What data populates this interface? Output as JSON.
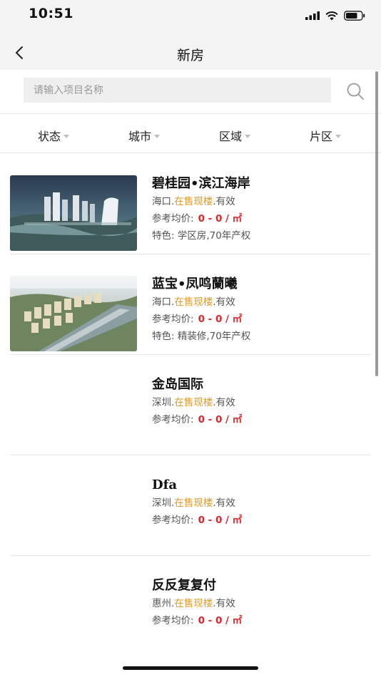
{
  "status_bar": {
    "time": "10:51"
  },
  "nav": {
    "title": "新房"
  },
  "search": {
    "placeholder": "请输入项目名称"
  },
  "filters": [
    "状态",
    "城市",
    "区域",
    "片区"
  ],
  "listings": [
    {
      "name": "碧桂园•滨江海岸",
      "city": "海口.",
      "status": "在售现楼",
      "validity": ".有效",
      "price_label": "参考均价:",
      "price": "0 - 0 / ㎡",
      "feature": "特色:  学区房,70年产权",
      "has_image": true
    },
    {
      "name": "蓝宝•凤鸣蘭曦",
      "city": "海口.",
      "status": "在售现楼",
      "validity": ".有效",
      "price_label": "参考均价:",
      "price": "0 - 0 / ㎡",
      "feature": "特色:  精装修,70年产权",
      "has_image": true
    },
    {
      "name": "金岛国际",
      "city": "深圳.",
      "status": "在售现楼",
      "validity": ".有效",
      "price_label": "参考均价:",
      "price": "0 - 0 / ㎡",
      "feature": "",
      "has_image": false
    },
    {
      "name": "Dfa",
      "city": "深圳.",
      "status": "在售现楼",
      "validity": ".有效",
      "price_label": "参考均价:",
      "price": "0 - 0 / ㎡",
      "feature": "",
      "has_image": false
    },
    {
      "name": "反反复复付",
      "city": "惠州.",
      "status": "在售现楼",
      "validity": ".有效",
      "price_label": "参考均价:",
      "price": "0 - 0 / ㎡",
      "feature": "",
      "has_image": false
    }
  ],
  "icons": {
    "back": "chevron-left-icon",
    "search": "search-icon",
    "signal": "signal-icon",
    "wifi": "wifi-icon",
    "battery": "battery-icon"
  },
  "colors": {
    "status": "#e19a25",
    "price": "#e0252a"
  }
}
